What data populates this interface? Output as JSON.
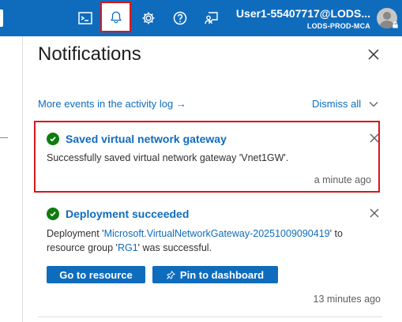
{
  "topbar": {
    "icons": [
      "cloud-shell-icon",
      "bell-icon",
      "settings-gear-icon",
      "help-icon",
      "feedback-icon"
    ],
    "user_name": "User1-55407717@LODS...",
    "directory": "LODS-PROD-MCA"
  },
  "panel": {
    "title": "Notifications",
    "activity_link": "More events in the activity log →",
    "dismiss_label": "Dismiss all"
  },
  "notifications": [
    {
      "title": "Saved virtual network gateway",
      "message": "Successfully saved virtual network gateway 'Vnet1GW'.",
      "time": "a minute ago"
    },
    {
      "title": "Deployment succeeded",
      "message_prefix": "Deployment '",
      "deployment_name": "Microsoft.VirtualNetworkGateway-20251009090419",
      "message_mid": "' to resource group '",
      "resource_group": "RG1",
      "message_suffix": "' was successful.",
      "go_button": "Go to resource",
      "pin_button": "Pin to dashboard",
      "time": "13 minutes ago"
    }
  ],
  "colors": {
    "accent": "#0f6cbd",
    "highlight": "#d9161c",
    "success": "#107c10"
  }
}
